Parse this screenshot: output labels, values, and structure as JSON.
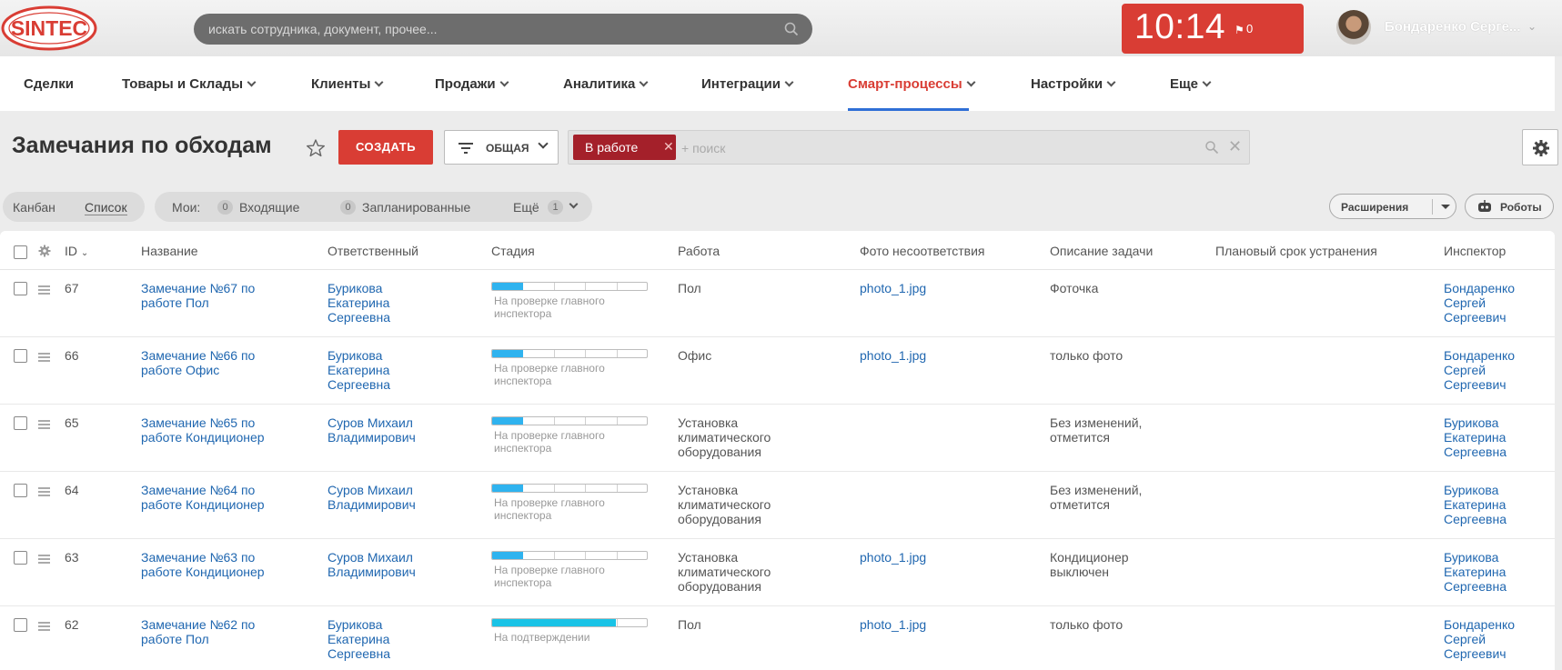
{
  "header": {
    "logo_text": "SINTEC",
    "search_placeholder": "искать сотрудника, документ, прочее...",
    "clock_time": "10:14",
    "flag_count": "0",
    "user_name": "Бондаренко Серге..."
  },
  "nav": {
    "items": [
      {
        "label": "Сделки",
        "dropdown": false
      },
      {
        "label": "Товары и Склады",
        "dropdown": true
      },
      {
        "label": "Клиенты",
        "dropdown": true
      },
      {
        "label": "Продажи",
        "dropdown": true
      },
      {
        "label": "Аналитика",
        "dropdown": true
      },
      {
        "label": "Интеграции",
        "dropdown": true
      },
      {
        "label": "Смарт-процессы",
        "dropdown": true,
        "active": true
      },
      {
        "label": "Настройки",
        "dropdown": true
      },
      {
        "label": "Еще",
        "dropdown": true
      }
    ]
  },
  "toolbar": {
    "title": "Замечания по обходам",
    "create_label": "СОЗДАТЬ",
    "filter_label": "ОБЩАЯ",
    "filter_tag": "В работе",
    "filter_placeholder": "+ поиск"
  },
  "views": {
    "kanban": "Канбан",
    "list": "Список",
    "my_label": "Мои:",
    "incoming_count": "0",
    "incoming_label": "Входящие",
    "planned_count": "0",
    "planned_label": "Запланированные",
    "more_label": "Ещё",
    "more_count": "1",
    "extensions_label": "Расширения",
    "robots_label": "Роботы"
  },
  "table": {
    "columns": [
      "ID",
      "Название",
      "Ответственный",
      "Стадия",
      "Работа",
      "Фото несоответствия",
      "Описание задачи",
      "Плановый срок устранения",
      "Инспектор"
    ],
    "rows": [
      {
        "id": "67",
        "name": "Замечание №67 по\nработе Пол",
        "responsible": "Бурикова\nЕкатерина\nСергеевна",
        "stage": "На проверке главного\nинспектора",
        "stage_progress": 0.2,
        "work": "Пол",
        "photo": "photo_1.jpg",
        "description": "Фоточка",
        "deadline": "",
        "inspector": "Бондаренко\nСергей\nСергеевич"
      },
      {
        "id": "66",
        "name": "Замечание №66 по\nработе Офис",
        "responsible": "Бурикова\nЕкатерина\nСергеевна",
        "stage": "На проверке главного\nинспектора",
        "stage_progress": 0.2,
        "work": "Офис",
        "photo": "photo_1.jpg",
        "description": "только фото",
        "deadline": "",
        "inspector": "Бондаренко\nСергей\nСергеевич"
      },
      {
        "id": "65",
        "name": "Замечание №65 по\nработе Кондиционер",
        "responsible": "Суров Михаил\nВладимирович",
        "stage": "На проверке главного\nинспектора",
        "stage_progress": 0.2,
        "work": "Установка\nклиматического\nоборудования",
        "photo": "",
        "description": "Без изменений,\nотметится",
        "deadline": "",
        "inspector": "Бурикова\nЕкатерина\nСергеевна"
      },
      {
        "id": "64",
        "name": "Замечание №64 по\nработе Кондиционер",
        "responsible": "Суров Михаил\nВладимирович",
        "stage": "На проверке главного\nинспектора",
        "stage_progress": 0.2,
        "work": "Установка\nклиматического\nоборудования",
        "photo": "",
        "description": "Без изменений,\nотметится",
        "deadline": "",
        "inspector": "Бурикова\nЕкатерина\nСергеевна"
      },
      {
        "id": "63",
        "name": "Замечание №63 по\nработе Кондиционер",
        "responsible": "Суров Михаил\nВладимирович",
        "stage": "На проверке главного\nинспектора",
        "stage_progress": 0.2,
        "work": "Установка\nклиматического\nоборудования",
        "photo": "photo_1.jpg",
        "description": "Кондиционер\nвыключен",
        "deadline": "",
        "inspector": "Бурикова\nЕкатерина\nСергеевна"
      },
      {
        "id": "62",
        "name": "Замечание №62 по\nработе Пол",
        "responsible": "Бурикова\nЕкатерина\nСергеевна",
        "stage": "На подтверждении",
        "stage_progress": 0.8,
        "work": "Пол",
        "photo": "photo_1.jpg",
        "description": "только фото",
        "deadline": "",
        "inspector": "Бондаренко\nСергей\nСергеевич"
      }
    ]
  },
  "colors": {
    "accent_red": "#d93d34",
    "tag_red": "#a4202a",
    "link_blue": "#2067b0",
    "stage_blue": "#2fb3ef",
    "stage_cyan": "#19c3e6"
  }
}
